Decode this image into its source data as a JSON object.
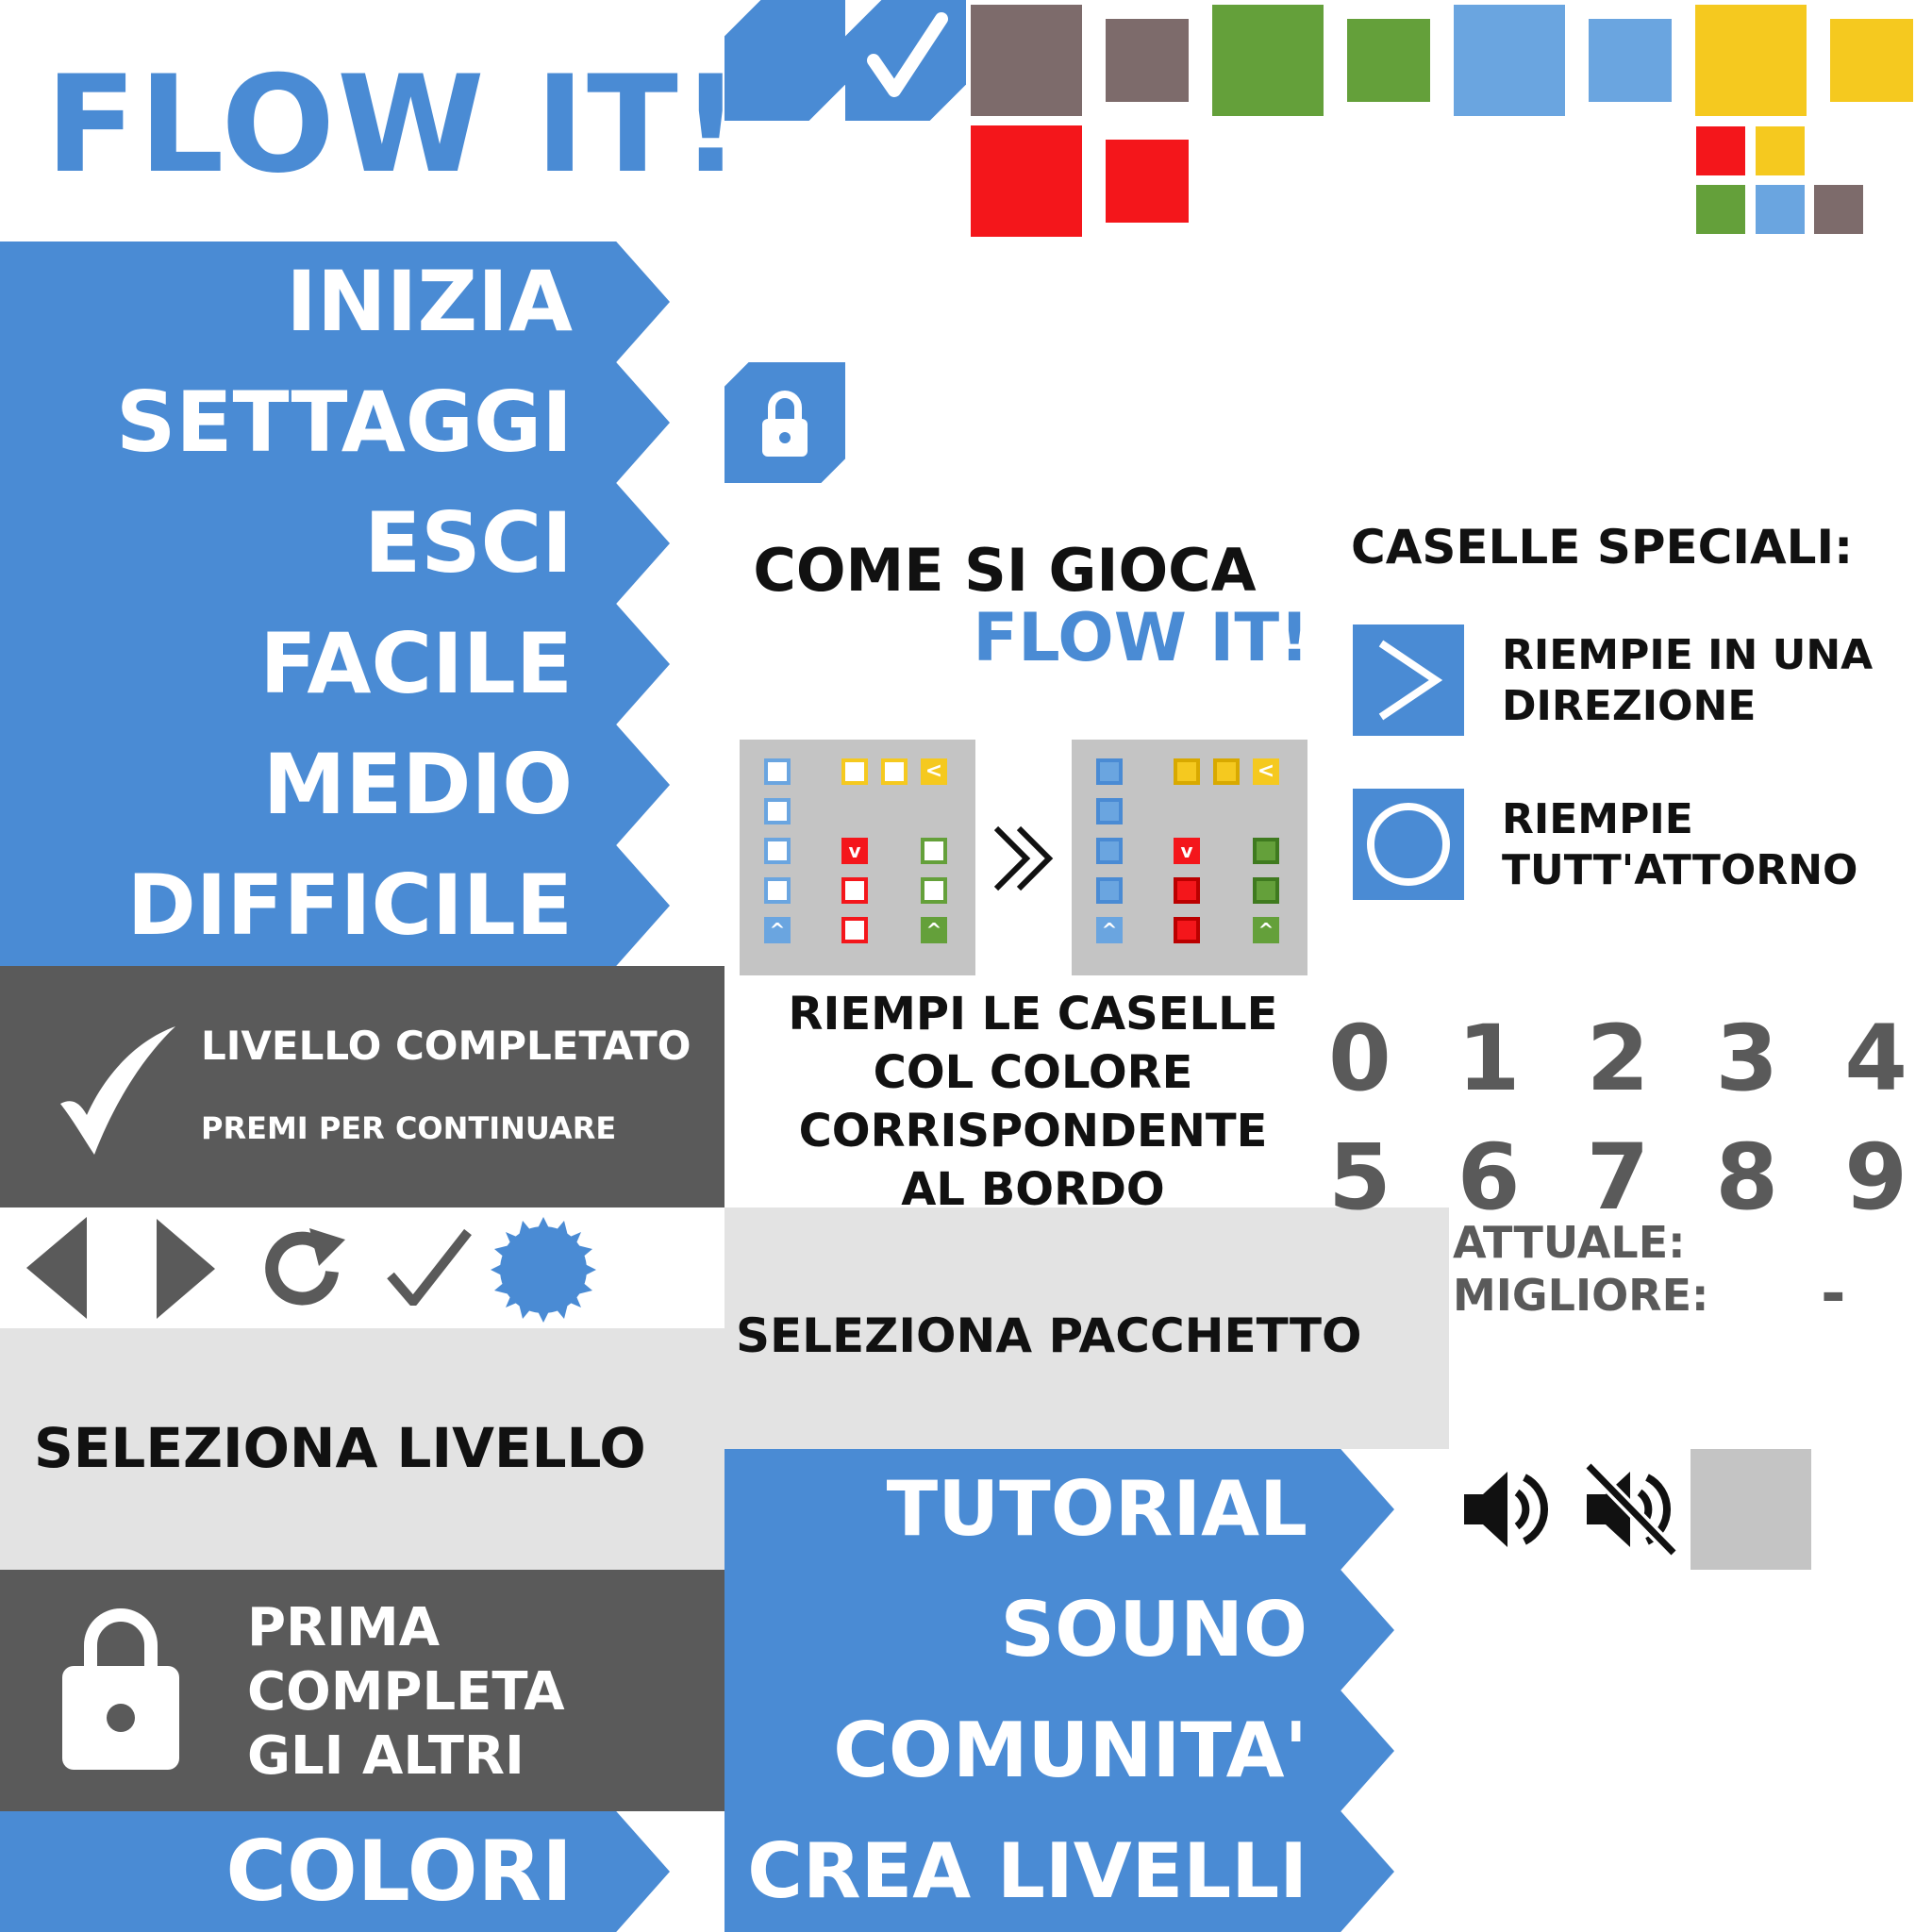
{
  "title": "FLOW IT!",
  "menu": {
    "inizia": "INIZIA",
    "settaggi": "SETTAGGI",
    "esci": "ESCI",
    "facile": "FACILE",
    "medio": "MEDIO",
    "difficile": "DIFFICILE",
    "colori": "COLORI",
    "tutorial": "TUTORIAL",
    "souno": "SOUNO",
    "comunita": "COMUNITA'",
    "crea_livelli": "CREA LIVELLI"
  },
  "tutorial": {
    "heading": "COME SI GIOCA",
    "brand": "FLOW IT!",
    "lines": [
      "RIEMPI LE CASELLE",
      "COL COLORE",
      "CORRISPONDENTE",
      "AL BORDO"
    ]
  },
  "special": {
    "heading": "CASELLE SPECIALI:",
    "direction_line1": "RIEMPIE IN UNA",
    "direction_line2": "DIREZIONE",
    "around_line1": "RIEMPIE",
    "around_line2": "TUTT'ATTORNO"
  },
  "complete": {
    "line1": "LIVELLO COMPLETATO",
    "line2": "PREMI PER CONTINUARE"
  },
  "locked": {
    "line1": "PRIMA",
    "line2": "COMPLETA",
    "line3": "GLI ALTRI"
  },
  "select_level": "SELEZIONA LIVELLO",
  "select_pack": "SELEZIONA PACCHETTO",
  "digits_row1": [
    "0",
    "1",
    "2",
    "3",
    "4"
  ],
  "digits_row2": [
    "5",
    "6",
    "7",
    "8",
    "9"
  ],
  "score": {
    "current_label": "ATTUALE:",
    "best_label": "MIGLIORE:",
    "best_value": "-"
  },
  "colors": {
    "blue": "#4a8bd4",
    "light_blue": "#6aa5e0",
    "brown": "#7d6b6b",
    "green": "#64a03a",
    "yellow": "#f5c91f",
    "red": "#f4161b",
    "dark_panel": "#5a5a5a",
    "light_panel": "#e3e3e3"
  },
  "icons": [
    "check-icon",
    "lock-icon",
    "play-left-icon",
    "play-right-icon",
    "refresh-icon",
    "badge-icon",
    "speaker-on-icon",
    "speaker-off-icon",
    "chevron-right-icon",
    "circle-icon",
    "double-chevron-icon"
  ]
}
